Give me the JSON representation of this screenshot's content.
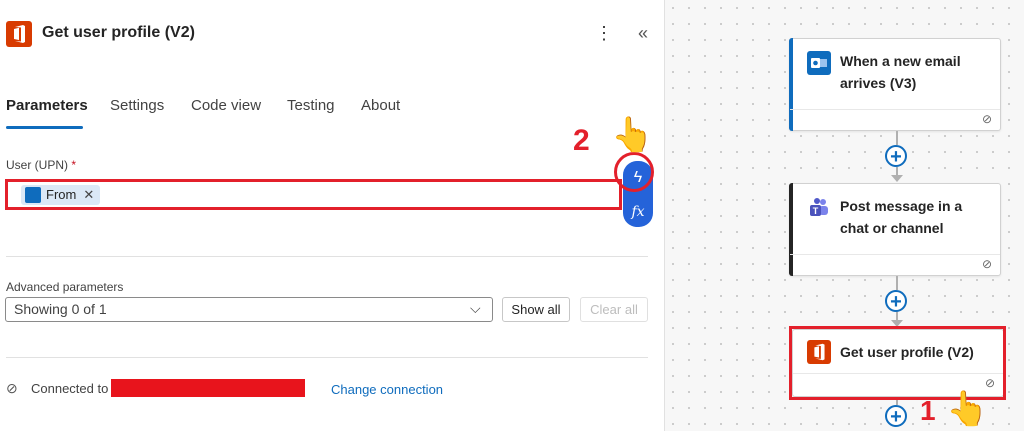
{
  "panel": {
    "title": "Get user profile (V2)",
    "more_icon": "⋮",
    "collapse_icon": "«",
    "tabs": [
      {
        "label": "Parameters",
        "active": true
      },
      {
        "label": "Settings",
        "active": false
      },
      {
        "label": "Code view",
        "active": false
      },
      {
        "label": "Testing",
        "active": false
      },
      {
        "label": "About",
        "active": false
      }
    ],
    "user_field": {
      "label": "User (UPN)",
      "required_mark": "*",
      "token_label": "From",
      "token_remove": "✕"
    },
    "dynamic_content": {
      "bolt_glyph": "ϟ",
      "fx_glyph": "fx"
    },
    "advanced": {
      "label": "Advanced parameters",
      "select_value": "Showing 0 of 1",
      "chevron": "⌵",
      "show_all": "Show all",
      "clear_all": "Clear all"
    },
    "connection": {
      "connected_to": "Connected to",
      "change_connection": "Change connection"
    }
  },
  "annotations": {
    "step2": "2",
    "step1": "1",
    "hand": "👆"
  },
  "flow": {
    "cards": [
      {
        "title": "When a new email arrives (V3)",
        "icon": "outlook-icon",
        "color": "#0f6cbd"
      },
      {
        "title": "Post message in a chat or channel",
        "icon": "teams-icon",
        "color": "#242424"
      },
      {
        "title": "Get user profile (V2)",
        "icon": "office-icon",
        "color": "#d83b01"
      }
    ],
    "plus_glyph": "+",
    "chain_glyph": "⊘"
  },
  "colors": {
    "accent": "#0f6cbd",
    "highlight": "#e3202b",
    "office": "#d83b01"
  }
}
